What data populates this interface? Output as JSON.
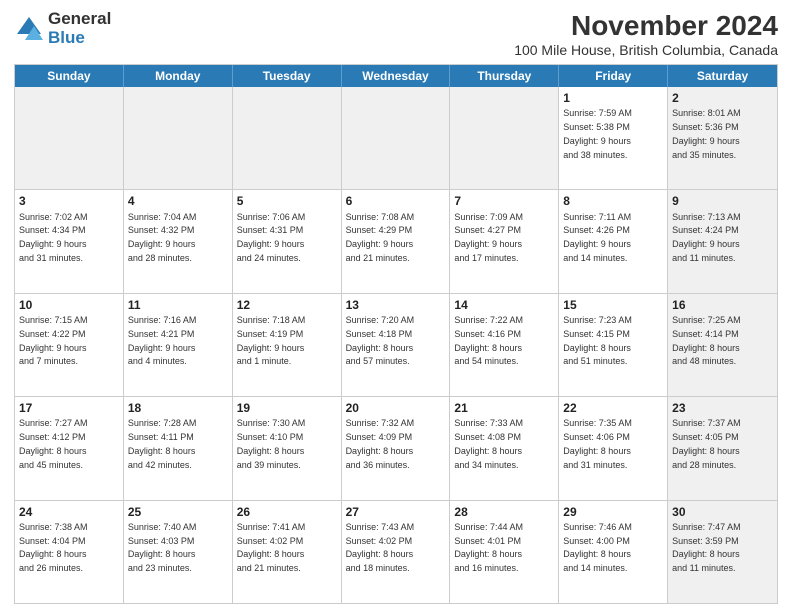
{
  "logo": {
    "line1": "General",
    "line2": "Blue"
  },
  "title": "November 2024",
  "subtitle": "100 Mile House, British Columbia, Canada",
  "header_days": [
    "Sunday",
    "Monday",
    "Tuesday",
    "Wednesday",
    "Thursday",
    "Friday",
    "Saturday"
  ],
  "weeks": [
    [
      {
        "day": "",
        "info": "",
        "shaded": true
      },
      {
        "day": "",
        "info": "",
        "shaded": true
      },
      {
        "day": "",
        "info": "",
        "shaded": true
      },
      {
        "day": "",
        "info": "",
        "shaded": true
      },
      {
        "day": "",
        "info": "",
        "shaded": true
      },
      {
        "day": "1",
        "info": "Sunrise: 7:59 AM\nSunset: 5:38 PM\nDaylight: 9 hours\nand 38 minutes.",
        "shaded": false
      },
      {
        "day": "2",
        "info": "Sunrise: 8:01 AM\nSunset: 5:36 PM\nDaylight: 9 hours\nand 35 minutes.",
        "shaded": true
      }
    ],
    [
      {
        "day": "3",
        "info": "Sunrise: 7:02 AM\nSunset: 4:34 PM\nDaylight: 9 hours\nand 31 minutes.",
        "shaded": false
      },
      {
        "day": "4",
        "info": "Sunrise: 7:04 AM\nSunset: 4:32 PM\nDaylight: 9 hours\nand 28 minutes.",
        "shaded": false
      },
      {
        "day": "5",
        "info": "Sunrise: 7:06 AM\nSunset: 4:31 PM\nDaylight: 9 hours\nand 24 minutes.",
        "shaded": false
      },
      {
        "day": "6",
        "info": "Sunrise: 7:08 AM\nSunset: 4:29 PM\nDaylight: 9 hours\nand 21 minutes.",
        "shaded": false
      },
      {
        "day": "7",
        "info": "Sunrise: 7:09 AM\nSunset: 4:27 PM\nDaylight: 9 hours\nand 17 minutes.",
        "shaded": false
      },
      {
        "day": "8",
        "info": "Sunrise: 7:11 AM\nSunset: 4:26 PM\nDaylight: 9 hours\nand 14 minutes.",
        "shaded": false
      },
      {
        "day": "9",
        "info": "Sunrise: 7:13 AM\nSunset: 4:24 PM\nDaylight: 9 hours\nand 11 minutes.",
        "shaded": true
      }
    ],
    [
      {
        "day": "10",
        "info": "Sunrise: 7:15 AM\nSunset: 4:22 PM\nDaylight: 9 hours\nand 7 minutes.",
        "shaded": false
      },
      {
        "day": "11",
        "info": "Sunrise: 7:16 AM\nSunset: 4:21 PM\nDaylight: 9 hours\nand 4 minutes.",
        "shaded": false
      },
      {
        "day": "12",
        "info": "Sunrise: 7:18 AM\nSunset: 4:19 PM\nDaylight: 9 hours\nand 1 minute.",
        "shaded": false
      },
      {
        "day": "13",
        "info": "Sunrise: 7:20 AM\nSunset: 4:18 PM\nDaylight: 8 hours\nand 57 minutes.",
        "shaded": false
      },
      {
        "day": "14",
        "info": "Sunrise: 7:22 AM\nSunset: 4:16 PM\nDaylight: 8 hours\nand 54 minutes.",
        "shaded": false
      },
      {
        "day": "15",
        "info": "Sunrise: 7:23 AM\nSunset: 4:15 PM\nDaylight: 8 hours\nand 51 minutes.",
        "shaded": false
      },
      {
        "day": "16",
        "info": "Sunrise: 7:25 AM\nSunset: 4:14 PM\nDaylight: 8 hours\nand 48 minutes.",
        "shaded": true
      }
    ],
    [
      {
        "day": "17",
        "info": "Sunrise: 7:27 AM\nSunset: 4:12 PM\nDaylight: 8 hours\nand 45 minutes.",
        "shaded": false
      },
      {
        "day": "18",
        "info": "Sunrise: 7:28 AM\nSunset: 4:11 PM\nDaylight: 8 hours\nand 42 minutes.",
        "shaded": false
      },
      {
        "day": "19",
        "info": "Sunrise: 7:30 AM\nSunset: 4:10 PM\nDaylight: 8 hours\nand 39 minutes.",
        "shaded": false
      },
      {
        "day": "20",
        "info": "Sunrise: 7:32 AM\nSunset: 4:09 PM\nDaylight: 8 hours\nand 36 minutes.",
        "shaded": false
      },
      {
        "day": "21",
        "info": "Sunrise: 7:33 AM\nSunset: 4:08 PM\nDaylight: 8 hours\nand 34 minutes.",
        "shaded": false
      },
      {
        "day": "22",
        "info": "Sunrise: 7:35 AM\nSunset: 4:06 PM\nDaylight: 8 hours\nand 31 minutes.",
        "shaded": false
      },
      {
        "day": "23",
        "info": "Sunrise: 7:37 AM\nSunset: 4:05 PM\nDaylight: 8 hours\nand 28 minutes.",
        "shaded": true
      }
    ],
    [
      {
        "day": "24",
        "info": "Sunrise: 7:38 AM\nSunset: 4:04 PM\nDaylight: 8 hours\nand 26 minutes.",
        "shaded": false
      },
      {
        "day": "25",
        "info": "Sunrise: 7:40 AM\nSunset: 4:03 PM\nDaylight: 8 hours\nand 23 minutes.",
        "shaded": false
      },
      {
        "day": "26",
        "info": "Sunrise: 7:41 AM\nSunset: 4:02 PM\nDaylight: 8 hours\nand 21 minutes.",
        "shaded": false
      },
      {
        "day": "27",
        "info": "Sunrise: 7:43 AM\nSunset: 4:02 PM\nDaylight: 8 hours\nand 18 minutes.",
        "shaded": false
      },
      {
        "day": "28",
        "info": "Sunrise: 7:44 AM\nSunset: 4:01 PM\nDaylight: 8 hours\nand 16 minutes.",
        "shaded": false
      },
      {
        "day": "29",
        "info": "Sunrise: 7:46 AM\nSunset: 4:00 PM\nDaylight: 8 hours\nand 14 minutes.",
        "shaded": false
      },
      {
        "day": "30",
        "info": "Sunrise: 7:47 AM\nSunset: 3:59 PM\nDaylight: 8 hours\nand 11 minutes.",
        "shaded": true
      }
    ]
  ]
}
